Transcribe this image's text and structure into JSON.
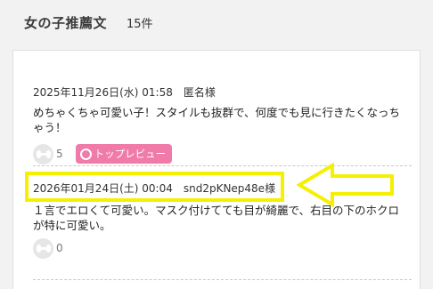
{
  "header": {
    "title": "女の子推薦文",
    "count": "15件"
  },
  "reviews": [
    {
      "date": "2025年11月26日(水) 01:58",
      "user": "匿名様",
      "text": "めちゃくちゃ可愛い子！スタイルも抜群で、何度でも見に行きたくなっちゃう！",
      "likes": "5",
      "badge": "トップレビュー"
    },
    {
      "date": "2026年01月24日(土) 00:04",
      "user": "snd2pKNep48e様",
      "text": "１言でエロくて可愛い。マスク付けてても目が綺麗で、右目の下のホクロが特に可愛い。",
      "likes": "0"
    }
  ],
  "annotation": {
    "highlight_color": "#f5f000",
    "arrow_color": "#f5f000"
  }
}
